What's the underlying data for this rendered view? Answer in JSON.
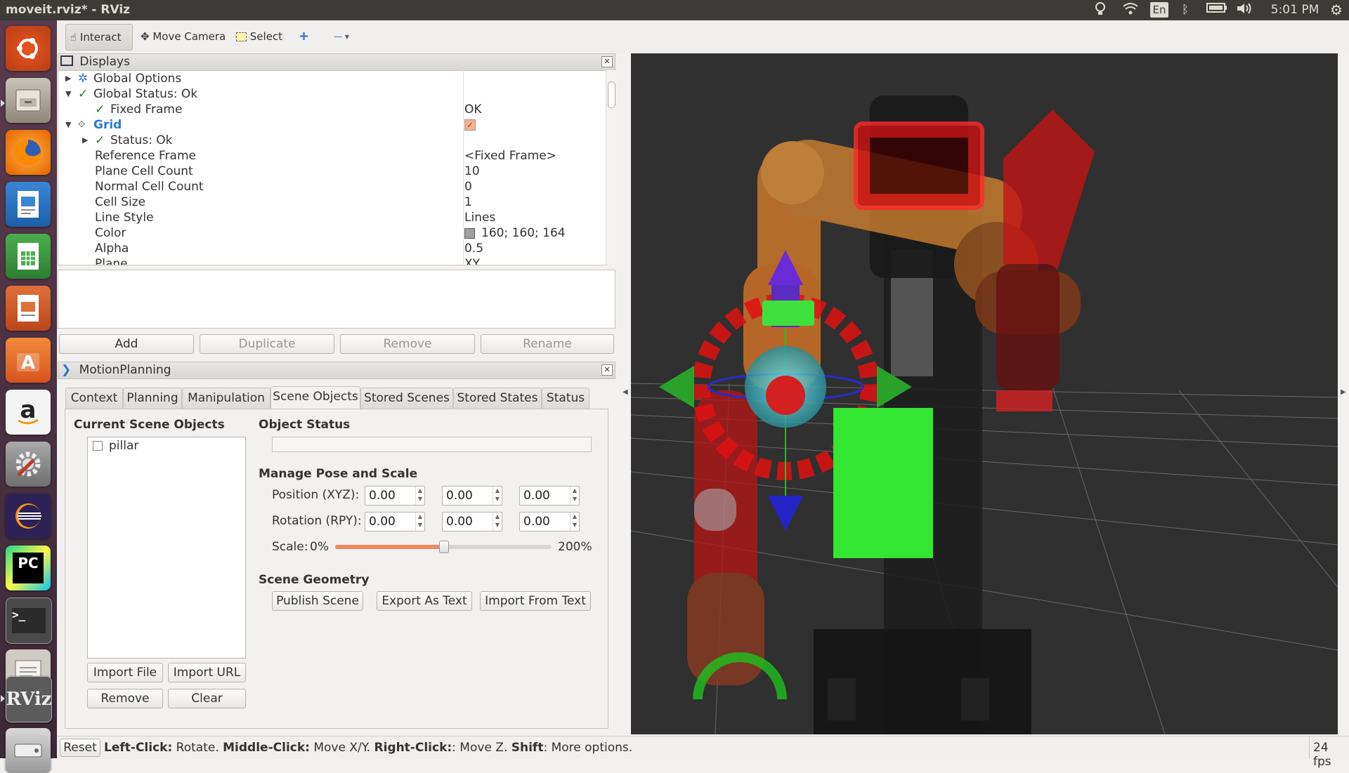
{
  "window": {
    "title": "moveit.rviz* - RViz"
  },
  "indicators": {
    "keyboard": "En",
    "clock": "5:01 PM"
  },
  "launcher": [
    "Ubuntu",
    "Files",
    "Firefox",
    "Writer",
    "Calc",
    "Impress",
    "Software",
    "Amazon",
    "Settings",
    "Eclipse",
    "PyCharm",
    "Terminal",
    "Editor",
    "RViz",
    "Disks"
  ],
  "toolbar": {
    "interact": "Interact",
    "move_camera": "Move Camera",
    "select": "Select",
    "plus": "+",
    "minus": "—"
  },
  "displays": {
    "title": "Displays",
    "rows": [
      {
        "label": "Global Options",
        "value": ""
      },
      {
        "label": "Global Status: Ok",
        "value": ""
      },
      {
        "label": "Fixed Frame",
        "value": "OK"
      },
      {
        "label": "Grid",
        "value": ""
      },
      {
        "label": "Status: Ok",
        "value": ""
      },
      {
        "label": "Reference Frame",
        "value": "<Fixed Frame>"
      },
      {
        "label": "Plane Cell Count",
        "value": "10"
      },
      {
        "label": "Normal Cell Count",
        "value": "0"
      },
      {
        "label": "Cell Size",
        "value": "1"
      },
      {
        "label": "Line Style",
        "value": "Lines"
      },
      {
        "label": "Color",
        "value": "160; 160; 164"
      },
      {
        "label": "Alpha",
        "value": "0.5"
      },
      {
        "label": "Plane",
        "value": "XY"
      }
    ],
    "buttons": {
      "add": "Add",
      "duplicate": "Duplicate",
      "remove": "Remove",
      "rename": "Rename"
    }
  },
  "motion_planning": {
    "title": "MotionPlanning",
    "tabs": [
      "Context",
      "Planning",
      "Manipulation",
      "Scene Objects",
      "Stored Scenes",
      "Stored States",
      "Status"
    ],
    "selected_tab": "Scene Objects",
    "current_scene_objects": {
      "heading": "Current Scene Objects",
      "items": [
        "pillar"
      ]
    },
    "object_status": {
      "heading": "Object Status",
      "value": ""
    },
    "manage_pose": {
      "heading": "Manage Pose and Scale",
      "position_label": "Position (XYZ):",
      "position": [
        "0.00",
        "0.00",
        "0.00"
      ],
      "rotation_label": "Rotation (RPY):",
      "rotation": [
        "0.00",
        "0.00",
        "0.00"
      ],
      "scale_label": "Scale:",
      "scale_min": "0%",
      "scale_max": "200%",
      "scale_value": 0.5
    },
    "scene_geometry": {
      "heading": "Scene Geometry",
      "publish": "Publish Scene",
      "export": "Export As Text",
      "import": "Import From Text"
    },
    "list_buttons": {
      "import_file": "Import File",
      "import_url": "Import URL",
      "remove": "Remove",
      "clear": "Clear"
    }
  },
  "statusbar": {
    "reset": "Reset",
    "hint": [
      {
        "key": "Left-Click:",
        "text": " Rotate. "
      },
      {
        "key": "Middle-Click:",
        "text": " Move X/Y. "
      },
      {
        "key": "Right-Click:",
        "text": ": Move Z. "
      },
      {
        "key": "Shift",
        "text": ": More options."
      }
    ],
    "fps": "24 fps"
  },
  "colors": {
    "launcher": "#4a3344",
    "topbar": "#3c3b37",
    "scene_object": "#32e632",
    "grid": "#a0a0a4",
    "viewport": "#303030"
  }
}
